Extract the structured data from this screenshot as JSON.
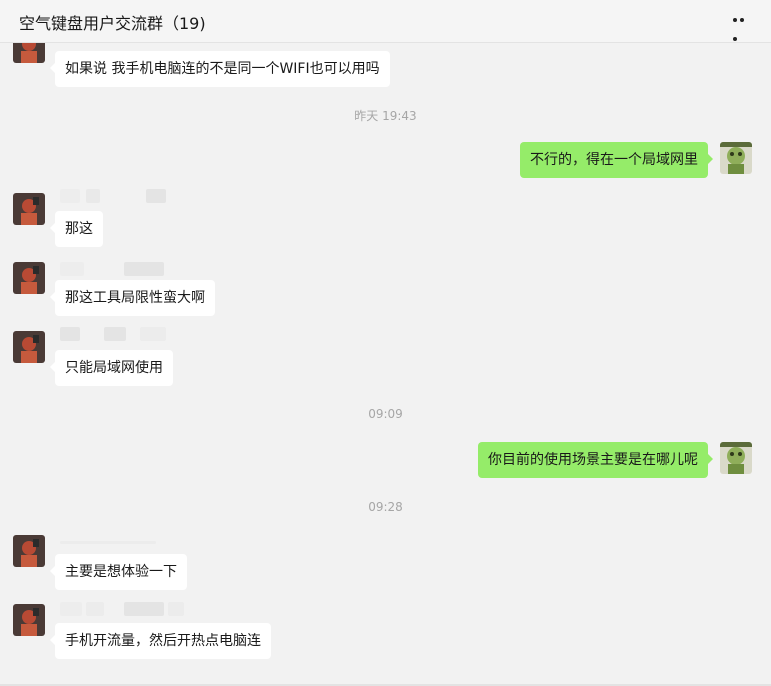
{
  "header": {
    "title": "空气键盘用户交流群（19)",
    "more_icon": "more-dots-icon"
  },
  "colors": {
    "background": "#f2f2f2",
    "incoming_bubble": "#ffffff",
    "outgoing_bubble": "#95ec69",
    "timestamp": "#a6a6a6"
  },
  "messages": [
    {
      "text": "如果说 我手机电脑连的不是同一个WIFI也可以用吗",
      "direction": "in"
    },
    {
      "timestamp": "昨天 19:43"
    },
    {
      "text": "不行的，得在一个局域网里",
      "direction": "out"
    },
    {
      "text": "那这",
      "direction": "in"
    },
    {
      "text": "那这工具局限性蛮大啊",
      "direction": "in"
    },
    {
      "text": "只能局域网使用",
      "direction": "in"
    },
    {
      "timestamp": "09:09"
    },
    {
      "text": "你目前的使用场景主要是在哪儿呢",
      "direction": "out"
    },
    {
      "timestamp": "09:28"
    },
    {
      "text": "主要是想体验一下",
      "direction": "in"
    },
    {
      "text": "手机开流量，然后开热点电脑连",
      "direction": "in"
    }
  ]
}
